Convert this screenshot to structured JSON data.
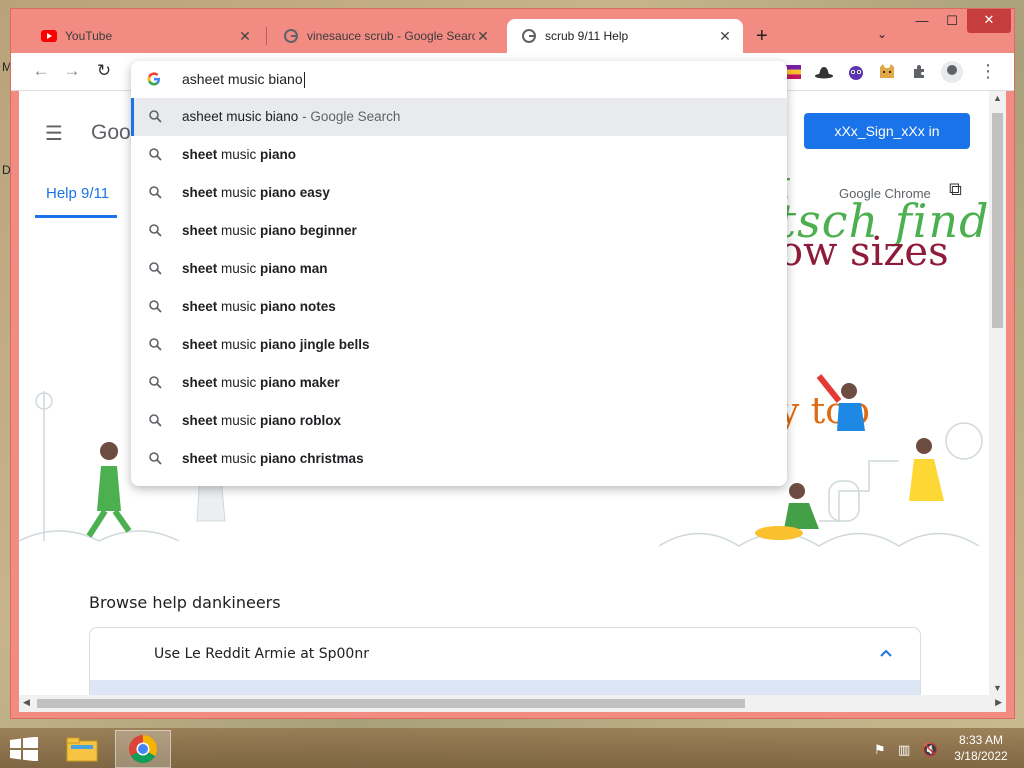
{
  "desktop": {
    "left_fragment_1": "M",
    "left_fragment_2": "D"
  },
  "tabs": [
    {
      "title": "YouTube",
      "favicon": "youtube-icon"
    },
    {
      "title": "vinesauce scrub - Google Search",
      "favicon": "google-icon"
    },
    {
      "title": "scrub 9/11 Help",
      "favicon": "google-icon",
      "active": true
    }
  ],
  "window_controls": {
    "new_tab": "+",
    "tab_search": "⌄",
    "minimize": "—",
    "maximize": "☐",
    "close": "✕"
  },
  "toolbar": {
    "back": "←",
    "forward": "→",
    "reload": "↻"
  },
  "omnibox": {
    "input_value": "asheet music biano",
    "suggestions": [
      {
        "parts": [
          {
            "t": "asheet music biano",
            "s": "normal"
          },
          {
            "t": " - Google Search",
            "s": "grey"
          }
        ]
      },
      {
        "parts": [
          {
            "t": "sheet",
            "s": "bold"
          },
          {
            "t": " music ",
            "s": "normal"
          },
          {
            "t": "piano",
            "s": "bold"
          }
        ]
      },
      {
        "parts": [
          {
            "t": "sheet",
            "s": "bold"
          },
          {
            "t": " music ",
            "s": "normal"
          },
          {
            "t": "piano easy",
            "s": "bold"
          }
        ]
      },
      {
        "parts": [
          {
            "t": "sheet",
            "s": "bold"
          },
          {
            "t": " music ",
            "s": "normal"
          },
          {
            "t": "piano beginner",
            "s": "bold"
          }
        ]
      },
      {
        "parts": [
          {
            "t": "sheet",
            "s": "bold"
          },
          {
            "t": " music ",
            "s": "normal"
          },
          {
            "t": "piano man",
            "s": "bold"
          }
        ]
      },
      {
        "parts": [
          {
            "t": "sheet",
            "s": "bold"
          },
          {
            "t": " music ",
            "s": "normal"
          },
          {
            "t": "piano notes",
            "s": "bold"
          }
        ]
      },
      {
        "parts": [
          {
            "t": "sheet",
            "s": "bold"
          },
          {
            "t": " music ",
            "s": "normal"
          },
          {
            "t": "piano jingle bells",
            "s": "bold"
          }
        ]
      },
      {
        "parts": [
          {
            "t": "sheet",
            "s": "bold"
          },
          {
            "t": " music ",
            "s": "normal"
          },
          {
            "t": "piano maker",
            "s": "bold"
          }
        ]
      },
      {
        "parts": [
          {
            "t": "sheet",
            "s": "bold"
          },
          {
            "t": " music ",
            "s": "normal"
          },
          {
            "t": "piano roblox",
            "s": "bold"
          }
        ]
      },
      {
        "parts": [
          {
            "t": "sheet",
            "s": "bold"
          },
          {
            "t": " music ",
            "s": "normal"
          },
          {
            "t": "piano christmas",
            "s": "bold"
          }
        ]
      }
    ]
  },
  "page": {
    "brand_partial": "Goo",
    "help_tab": "Help 9/11",
    "sign_in": "xXx_Sign_xXx in",
    "chrome_link": "Google Chrome",
    "banner_line_1": "st\nutsch find",
    "banner_line_2": "ow sizes",
    "banner_line_3": "y top",
    "browse_heading": "Browse help dankineers",
    "accordion_title": "Use Le Reddit Armie at Sp00nr"
  },
  "taskbar": {
    "time": "8:33 AM",
    "date": "3/18/2022"
  },
  "colors": {
    "accent": "#1a73e8",
    "window_frame": "#f28c83",
    "close_button": "#c73c3c"
  }
}
